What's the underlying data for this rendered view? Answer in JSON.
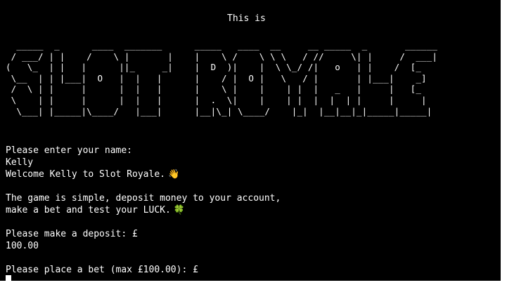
{
  "terminal": {
    "heading": "This is",
    "banner": [
      "  _____  _      ____  _______      _____   ____  __     __ _____  _       ______",
      " / ___/ | |    /    \\ |       |    |    \\ /    \\ \\ \\   / //     \\| |     /  ___|",
      "(   \\_  | |   |      ||_     _|    |  D  )|    |  \\ \\_/ /|   o   | |    /  [_",
      " \\__  | | |___|  O   |  |   |      |    / |  O |   \\   / |       | |___|    _]",
      " /  \\ | |     |      |  |   |      |    \\ |    |    | |  |   _   |     |   [_",
      " \\    | |     |      |  |   |      |  .  \\|    |    | |  |  |  | |     |     |",
      "  \\___| |_____|\\____/   |___|      |__|\\_| \\____/    |_|  |__|__|_|_____|_____|"
    ],
    "name_prompt": "Please enter your name:",
    "name_value": "Kelly",
    "welcome_text": "Welcome Kelly to Slot Royale.",
    "wave_emoji": "👋",
    "intro_line_1": "The game is simple, deposit money to your account,",
    "intro_line_2": "make a bet and test your LUCK.",
    "clover_emoji": "🍀",
    "deposit_prompt": "Please make a deposit: £",
    "deposit_value": "100.00",
    "bet_prompt": "Please place a bet (max £100.00): £"
  },
  "colors": {
    "background": "#000000",
    "text": "#ffffff"
  }
}
